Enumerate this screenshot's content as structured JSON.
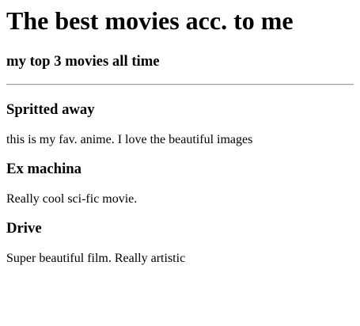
{
  "page": {
    "title": "The best movies acc. to me",
    "subtitle": "my top 3 movies all time"
  },
  "movies": [
    {
      "name": "Spritted away",
      "description": "this is my fav. anime. I love the beautiful images"
    },
    {
      "name": "Ex machina",
      "description": "Really cool sci-fic movie."
    },
    {
      "name": "Drive",
      "description": "Super beautiful film. Really artistic"
    }
  ]
}
